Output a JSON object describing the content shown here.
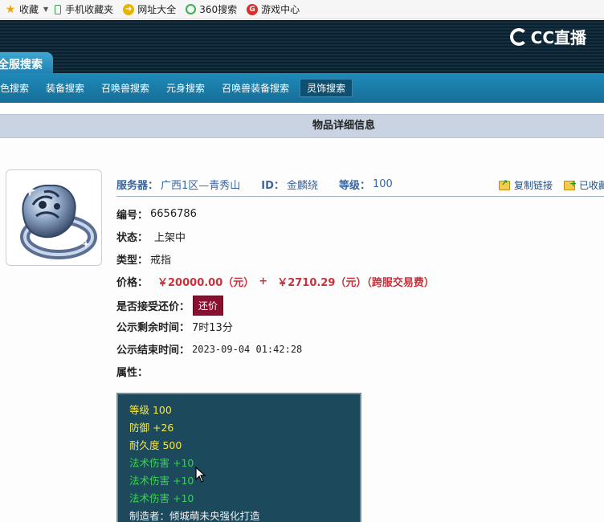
{
  "bookmarks": [
    {
      "label": "收藏",
      "icon": "star-icon"
    },
    {
      "label": "手机收藏夹",
      "icon": "phone-icon"
    },
    {
      "label": "网址大全",
      "icon": "site-nav-icon"
    },
    {
      "label": "360搜索",
      "icon": "360-search-icon"
    },
    {
      "label": "游戏中心",
      "icon": "game-center-icon"
    }
  ],
  "header": {
    "logo_text": "CC直播",
    "main_tab": "全服搜索"
  },
  "nav": {
    "items": [
      "角色搜索",
      "装备搜索",
      "召唤兽搜索",
      "元身搜索",
      "召唤兽装备搜索",
      "灵饰搜索"
    ],
    "active_index": 5
  },
  "detail": {
    "title": "物品详细信息",
    "server_label": "服务器：",
    "server_value": "广西1区—青秀山",
    "id_label": "ID：",
    "id_value": "金麟绕",
    "level_label": "等级：",
    "level_value": "100",
    "copy_link": "复制链接",
    "favorite": "已收藏",
    "code_label": "编号：",
    "code_value": "6656786",
    "status_label": "状态：",
    "status_value": "上架中",
    "type_label": "类型：",
    "type_value": "戒指",
    "price_label": "价格：",
    "price_value": "￥20000.00（元）",
    "price_plus": "+",
    "fee_value": "￥2710.29（元）（跨服交易费）",
    "counter_label": "是否接受还价：",
    "counter_button": "还价",
    "remain_label": "公示剩余时间：",
    "remain_value": "7时13分",
    "end_label": "公示结束时间：",
    "end_value": "2023-09-04 01:42:28",
    "attr_label": "属性："
  },
  "attributes": [
    {
      "text": "等级 100",
      "color": "yellow"
    },
    {
      "text": "防御 +26",
      "color": "yellow"
    },
    {
      "text": "耐久度 500",
      "color": "yellow"
    },
    {
      "text": "法术伤害 +10",
      "color": "green"
    },
    {
      "text": "法术伤害 +10",
      "color": "green"
    },
    {
      "text": "法术伤害 +10",
      "color": "green"
    },
    {
      "text": "制造者：倾城萌未央强化打造",
      "color": "white"
    }
  ],
  "colors": {
    "nav_bg": "#1f8ab9",
    "price": "#c8323b",
    "counter_button": "#8a1030",
    "attr_box": "#1c4a5c"
  }
}
